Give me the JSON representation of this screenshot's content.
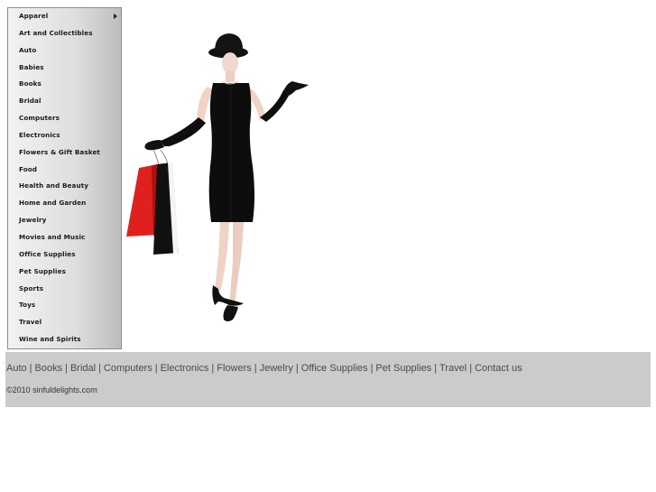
{
  "menu": {
    "items": [
      {
        "label": "Apparel",
        "submenu": true
      },
      {
        "label": "Art and Collectibles"
      },
      {
        "label": "Auto"
      },
      {
        "label": "Babies"
      },
      {
        "label": "Books"
      },
      {
        "label": "Bridal"
      },
      {
        "label": "Computers"
      },
      {
        "label": "Electronics"
      },
      {
        "label": "Flowers & Gift Basket"
      },
      {
        "label": "Food"
      },
      {
        "label": "Health and Beauty"
      },
      {
        "label": "Home and Garden"
      },
      {
        "label": "Jewelry"
      },
      {
        "label": "Movies and Music"
      },
      {
        "label": "Office Supplies"
      },
      {
        "label": "Pet Supplies"
      },
      {
        "label": "Sports"
      },
      {
        "label": "Toys"
      },
      {
        "label": "Travel"
      },
      {
        "label": "Wine and Spirits"
      }
    ]
  },
  "footer": {
    "links": [
      "Auto",
      "Books",
      "Bridal",
      "Computers",
      "Electronics",
      "Flowers",
      "Jewelry",
      "Office Supplies",
      "Pet Supplies",
      "Travel",
      "Contact us"
    ],
    "separator": "|",
    "copyright": "©2010 sinfuldelights.com"
  },
  "colors": {
    "footer_bg": "#cbcbcb",
    "link_color": "#4a4a4a",
    "bag_red": "#e0201c"
  }
}
